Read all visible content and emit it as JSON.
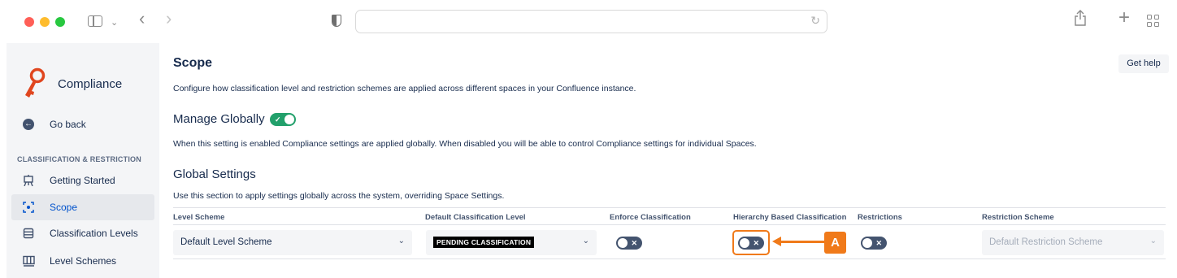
{
  "browser": {
    "url": "",
    "icons": [
      "sidebar-icon",
      "chevron-down-icon",
      "back-icon",
      "forward-icon",
      "shield-icon",
      "reload-icon",
      "share-icon",
      "new-tab-icon",
      "tab-overview-icon"
    ]
  },
  "sidebar": {
    "app_name": "Compliance",
    "back_label": "Go back",
    "section_label": "CLASSIFICATION & RESTRICTION",
    "items": [
      {
        "label": "Getting Started",
        "icon": "easel-icon",
        "selected": false
      },
      {
        "label": "Scope",
        "icon": "scope-icon",
        "selected": true
      },
      {
        "label": "Classification Levels",
        "icon": "list-icon",
        "selected": false
      },
      {
        "label": "Level Schemes",
        "icon": "columns-icon",
        "selected": false
      }
    ]
  },
  "header": {
    "title": "Scope",
    "description": "Configure how classification level and restriction schemes are applied across different spaces in your Confluence instance.",
    "help_label": "Get help"
  },
  "manage_globally": {
    "title": "Manage Globally",
    "enabled": true,
    "description": "When this setting is enabled Compliance settings are applied globally. When disabled you will be able to control Compliance settings for individual Spaces."
  },
  "global_settings": {
    "title": "Global Settings",
    "description": "Use this section to apply settings globally across the system, overriding Space Settings.",
    "columns": [
      "Level Scheme",
      "Default Classification Level",
      "Enforce Classification",
      "Hierarchy Based Classification",
      "Restrictions",
      "Restriction Scheme"
    ],
    "row": {
      "level_scheme": "Default Level Scheme",
      "default_classification": "PENDING CLASSIFICATION",
      "enforce_classification": false,
      "hierarchy_based_classification": false,
      "restrictions": false,
      "restriction_scheme": "Default Restriction Scheme"
    }
  },
  "annotation": {
    "callout_label": "A",
    "color": "#f07a1a"
  },
  "colors": {
    "toggle_on": "#22a06b",
    "toggle_off": "#44546f",
    "selected_text": "#0052cc",
    "sidebar_bg": "#f4f5f7"
  }
}
